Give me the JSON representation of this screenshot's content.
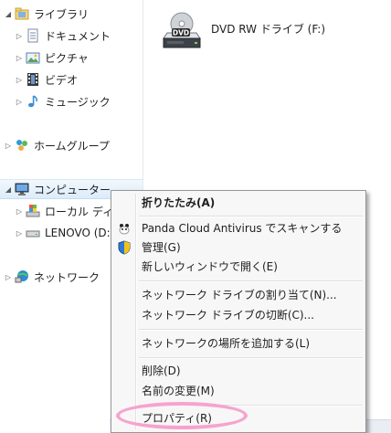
{
  "nav": {
    "library": "ライブラリ",
    "documents": "ドキュメント",
    "pictures": "ピクチャ",
    "videos": "ビデオ",
    "music": "ミュージック",
    "homegroup": "ホームグループ",
    "computer": "コンピューター",
    "local_disk": "ローカル ディ",
    "lenovo": "LENOVO (D:",
    "network": "ネットワーク"
  },
  "content": {
    "dvd_drive_label": "DVD RW ドライブ (F:)",
    "dvd_badge": "DVD"
  },
  "context_menu": {
    "collapse": "折りたたみ(A)",
    "scan": "Panda Cloud Antivirus でスキャンする",
    "manage": "管理(G)",
    "open_new_window": "新しいウィンドウで開く(E)",
    "map_network_drive": "ネットワーク ドライブの割り当て(N)...",
    "disconnect_network_drive": "ネットワーク ドライブの切断(C)...",
    "add_network_location": "ネットワークの場所を追加する(L)",
    "delete": "削除(D)",
    "rename": "名前の変更(M)",
    "properties": "プロパティ(R)"
  },
  "colors": {
    "selection": "#dcecfa",
    "highlight_ring": "#f6a3cf",
    "menu_bg": "#f7f7f7"
  }
}
